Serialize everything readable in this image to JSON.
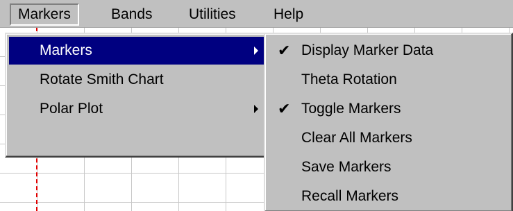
{
  "menubar": {
    "items": [
      {
        "label": "Markers"
      },
      {
        "label": "Bands"
      },
      {
        "label": "Utilities"
      },
      {
        "label": "Help"
      }
    ]
  },
  "markers_menu": {
    "items": [
      {
        "label": "Markers"
      },
      {
        "label": "Rotate Smith Chart"
      },
      {
        "label": "Polar Plot"
      }
    ]
  },
  "markers_submenu": {
    "items": [
      {
        "label": "Display Marker Data",
        "checked": true
      },
      {
        "label": "Theta Rotation",
        "checked": false
      },
      {
        "label": "Toggle Markers",
        "checked": true
      },
      {
        "label": "Clear All Markers",
        "checked": false
      },
      {
        "label": "Save Markers",
        "checked": false
      },
      {
        "label": "Recall Markers",
        "checked": false
      }
    ]
  },
  "icons": {
    "check": "✔",
    "submenu_arrow": "chevron-right-icon"
  },
  "colors": {
    "menu_bg": "#c0c0c0",
    "highlight_bg": "#000080",
    "highlight_text": "#ffffff",
    "grid_line": "#c8c8c8",
    "marker_line": "#e00000"
  }
}
